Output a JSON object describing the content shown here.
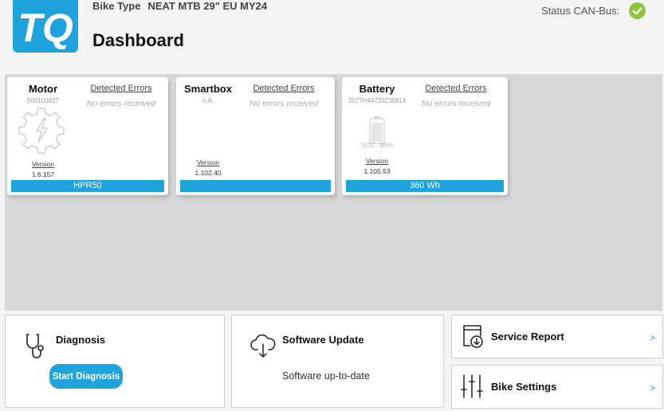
{
  "header": {
    "logo_text": "TQ",
    "bike_type_label": "Bike Type",
    "bike_type_value": "NEAT MTB 29\" EU MY24",
    "page_title": "Dashboard",
    "status_label": "Status CAN-Bus:",
    "status_icon": "check-circle-icon",
    "status_color": "#8cc63f"
  },
  "accent_color": "#1fa3dc",
  "components": {
    "motor": {
      "title": "Motor",
      "serial": "500103837",
      "errors_title": "Detected Errors",
      "errors_text": "No errors received",
      "icon": "motor-gear-icon",
      "version_label": "Version",
      "version_value": "1.6.157",
      "bar_text": "HPR50"
    },
    "smartbox": {
      "title": "Smartbox",
      "serial": "n.A.",
      "errors_title": "Detected Errors",
      "errors_text": "No errors received",
      "version_label": "Version",
      "version_value": "1.102.40",
      "bar_text": ""
    },
    "battery": {
      "title": "Battery",
      "serial": "2077H44720235814",
      "errors_title": "Detected Errors",
      "errors_text": "No errors received",
      "icon": "battery-icon",
      "soc": "SOC: 86%",
      "version_label": "Version",
      "version_value": "1.105.53",
      "bar_text": "360 Wh"
    }
  },
  "tiles": {
    "diagnosis": {
      "title": "Diagnosis",
      "icon": "stethoscope-icon",
      "button_label": "Start Diagnosis"
    },
    "software_update": {
      "title": "Software Update",
      "icon": "cloud-download-icon",
      "status": "Software up-to-date"
    },
    "service_report": {
      "title": "Service Report",
      "icon": "report-download-icon",
      "chevron": ">"
    },
    "bike_settings": {
      "title": "Bike Settings",
      "icon": "sliders-icon",
      "chevron": ">"
    }
  }
}
